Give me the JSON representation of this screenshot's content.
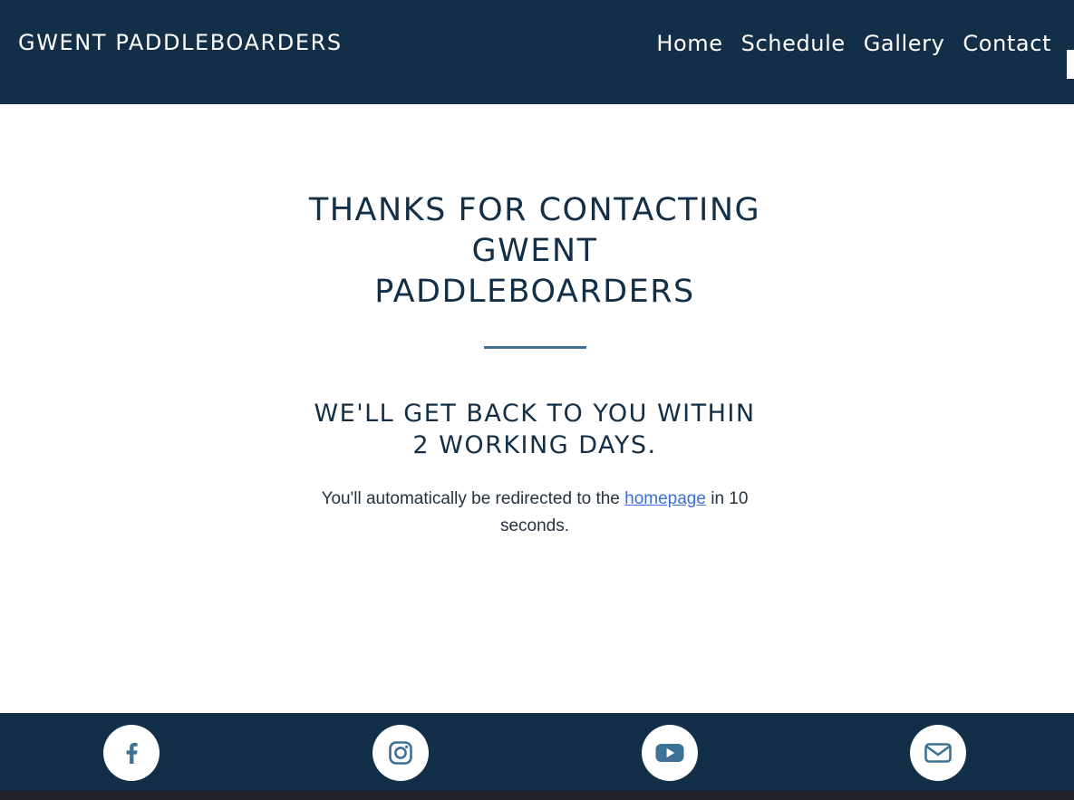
{
  "header": {
    "brand": "GWENT PADDLEBOARDERS",
    "nav": [
      {
        "label": "Home"
      },
      {
        "label": "Schedule"
      },
      {
        "label": "Gallery"
      },
      {
        "label": "Contact"
      }
    ]
  },
  "main": {
    "title_lines": [
      "THANKS FOR CONTACTING",
      "GWENT",
      "PADDLEBOARDERS"
    ],
    "subtitle_lines": [
      "WE'LL GET BACK TO YOU WITHIN",
      "2 WORKING DAYS."
    ],
    "message_before": "You'll automatically be redirected to the ",
    "message_link": "homepage",
    "message_after": " in 10 seconds."
  },
  "footer": {
    "social": [
      {
        "icon": "facebook-icon"
      },
      {
        "icon": "instagram-icon"
      },
      {
        "icon": "youtube-icon"
      },
      {
        "icon": "email-icon"
      }
    ]
  },
  "colors": {
    "navy": "#132f47",
    "accent": "#3d7296",
    "link": "#3b6fd6"
  }
}
